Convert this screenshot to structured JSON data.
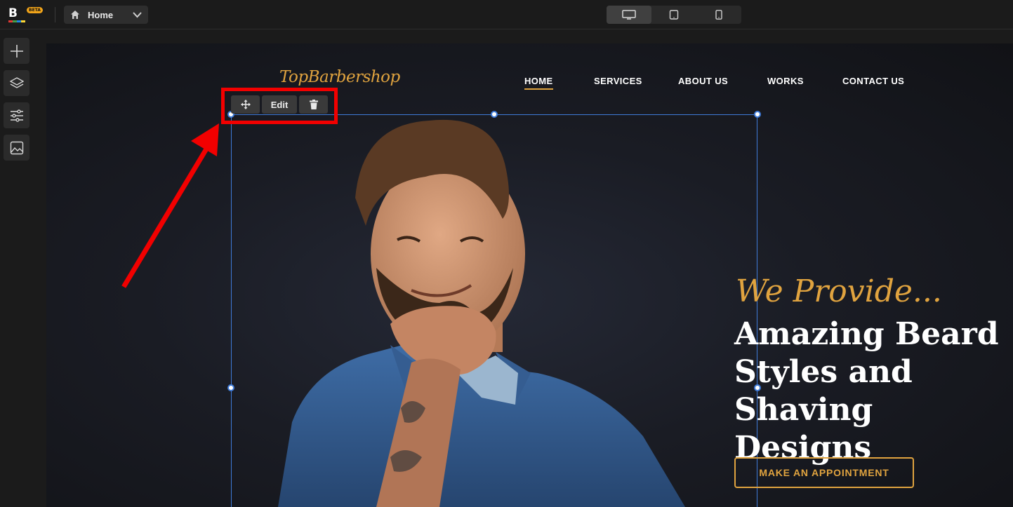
{
  "editor": {
    "logo_letter": "B",
    "logo_badge": "BETA",
    "page_selector": {
      "label": "Home",
      "icon": "home-icon",
      "chevron": "chevron-down-icon"
    },
    "devices": [
      {
        "name": "desktop",
        "icon": "monitor-icon",
        "active": true
      },
      {
        "name": "tablet",
        "icon": "tablet-icon",
        "active": false
      },
      {
        "name": "mobile",
        "icon": "phone-icon",
        "active": false
      }
    ],
    "tools": [
      {
        "name": "add",
        "icon": "plus-icon"
      },
      {
        "name": "layers",
        "icon": "layers-icon"
      },
      {
        "name": "settings",
        "icon": "sliders-icon"
      },
      {
        "name": "media",
        "icon": "image-icon"
      }
    ],
    "element_toolbar": {
      "move_icon": "move-icon",
      "edit_label": "Edit",
      "delete_icon": "trash-icon"
    },
    "annotation_color": "#f20000",
    "selection_color": "#3f7bd9"
  },
  "site": {
    "brand": "TopBarbershop",
    "nav": [
      "HOME",
      "SERVICES",
      "ABOUT US",
      "WORKS",
      "CONTACT US"
    ],
    "active_nav": "HOME",
    "hero": {
      "kicker": "We Provide...",
      "headline_lines": [
        "Amazing Beard",
        "Styles and",
        "Shaving Designs"
      ],
      "cta": "MAKE AN APPOINTMENT"
    },
    "accent": "#e0a33f"
  }
}
